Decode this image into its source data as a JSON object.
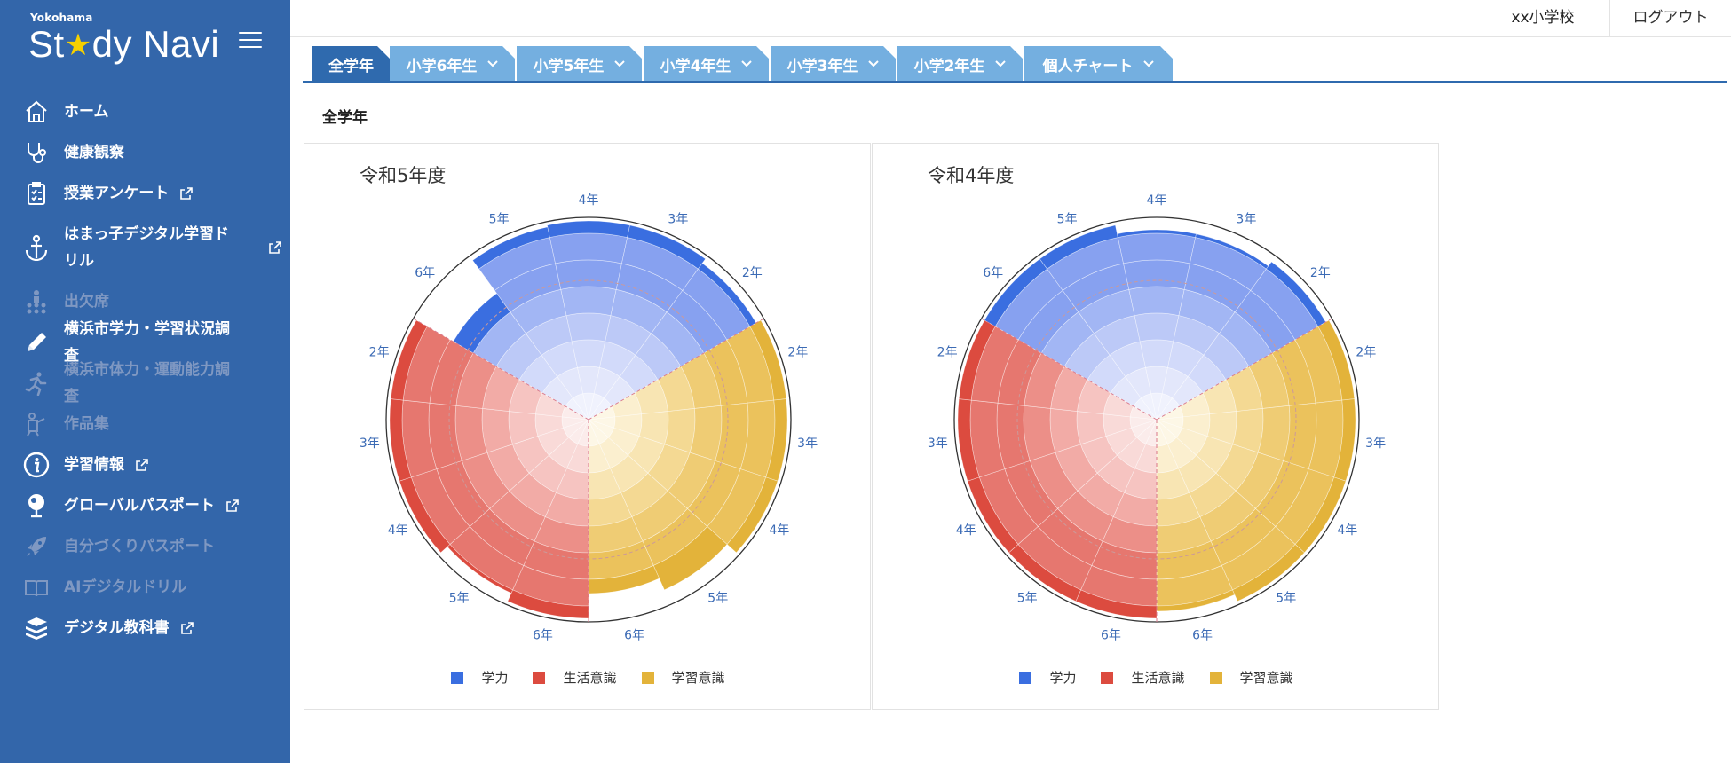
{
  "brand": {
    "small": "Yokohama",
    "main_left": "St",
    "main_right": "dy Navi"
  },
  "header": {
    "school": "xx小学校",
    "logout": "ログアウト"
  },
  "sidebar": {
    "items": [
      {
        "label": "ホーム",
        "icon": "home-icon",
        "state": "normal"
      },
      {
        "label": "健康観察",
        "icon": "stethoscope-icon",
        "state": "normal"
      },
      {
        "label": "授業アンケート",
        "icon": "clipboard-icon",
        "state": "normal",
        "external": true
      },
      {
        "label": "はまっ子デジタル学習ドリル",
        "icon": "anchor-icon",
        "state": "normal",
        "external": true
      },
      {
        "label": "出欠席",
        "icon": "attendance-icon",
        "state": "muted"
      },
      {
        "label": "横浜市学力・学習状況調査",
        "icon": "pencil-icon",
        "state": "active"
      },
      {
        "label": "横浜市体力・運動能力調査",
        "icon": "running-icon",
        "state": "muted"
      },
      {
        "label": "作品集",
        "icon": "easel-icon",
        "state": "muted"
      },
      {
        "label": "学習情報",
        "icon": "info-icon",
        "state": "normal",
        "external": true
      },
      {
        "label": "グローバルパスポート",
        "icon": "globe-icon",
        "state": "normal",
        "external": true
      },
      {
        "label": "自分づくりパスポート",
        "icon": "rocket-icon",
        "state": "muted"
      },
      {
        "label": "AIデジタルドリル",
        "icon": "book-open-icon",
        "state": "muted"
      },
      {
        "label": "デジタル教科書",
        "icon": "books-icon",
        "state": "normal",
        "external": true
      }
    ]
  },
  "tabs": [
    {
      "label": "全学年",
      "active": true,
      "dropdown": false
    },
    {
      "label": "小学6年生",
      "active": false,
      "dropdown": true
    },
    {
      "label": "小学5年生",
      "active": false,
      "dropdown": true
    },
    {
      "label": "小学4年生",
      "active": false,
      "dropdown": true
    },
    {
      "label": "小学3年生",
      "active": false,
      "dropdown": true
    },
    {
      "label": "小学2年生",
      "active": false,
      "dropdown": true
    },
    {
      "label": "個人チャート",
      "active": false,
      "dropdown": true
    }
  ],
  "section_title": "全学年",
  "colors": {
    "sidebar": "#3366aa",
    "tab": "#74afe0",
    "tab_active": "#2f6aae",
    "gakuryoku": "#3a6ee0",
    "seikatsu": "#dc4b3f",
    "gakushu": "#e3b33a"
  },
  "chart_data": [
    {
      "type": "polar-bar",
      "title": "令和5年度",
      "categories": [
        "4年",
        "3年",
        "2年",
        "2年",
        "3年",
        "4年",
        "5年",
        "6年",
        "6年",
        "5年",
        "4年",
        "3年",
        "2年",
        "6年",
        "5年"
      ],
      "legend": [
        "学力",
        "生活意識",
        "学習意識"
      ],
      "series": [
        {
          "name": "学力",
          "categories": [
            "6年",
            "5年",
            "4年",
            "3年",
            "2年"
          ],
          "values": [
            0.43,
            0.66,
            0.67,
            0.79,
            0.64
          ]
        },
        {
          "name": "学習意識",
          "categories": [
            "2年",
            "3年",
            "4年",
            "5年",
            "6年"
          ],
          "values": [
            0.7,
            0.75,
            0.78,
            0.6,
            0.53
          ]
        },
        {
          "name": "生活意識",
          "categories": [
            "6年",
            "5年",
            "4年",
            "3年",
            "2年"
          ],
          "values": [
            0.82,
            0.62,
            0.92,
            0.92,
            0.71
          ]
        }
      ]
    },
    {
      "type": "polar-bar",
      "title": "令和4年度",
      "categories": [
        "4年",
        "3年",
        "2年",
        "2年",
        "3年",
        "4年",
        "5年",
        "6年",
        "6年",
        "5年",
        "4年",
        "3年",
        "2年",
        "6年",
        "5年"
      ],
      "legend": [
        "学力",
        "生活意識",
        "学習意識"
      ],
      "series": [
        {
          "name": "学力",
          "categories": [
            "6年",
            "5年",
            "4年",
            "3年",
            "2年"
          ],
          "values": [
            0.73,
            0.7,
            0.62,
            0.62,
            0.65
          ]
        },
        {
          "name": "学習意識",
          "categories": [
            "2年",
            "3年",
            "4年",
            "5年",
            "6年"
          ],
          "values": [
            0.77,
            0.77,
            0.72,
            0.9,
            0.63
          ]
        },
        {
          "name": "生活意識",
          "categories": [
            "6年",
            "5年",
            "4年",
            "3年",
            "2年"
          ],
          "values": [
            0.81,
            0.77,
            0.7,
            0.78,
            0.83
          ]
        }
      ]
    }
  ]
}
